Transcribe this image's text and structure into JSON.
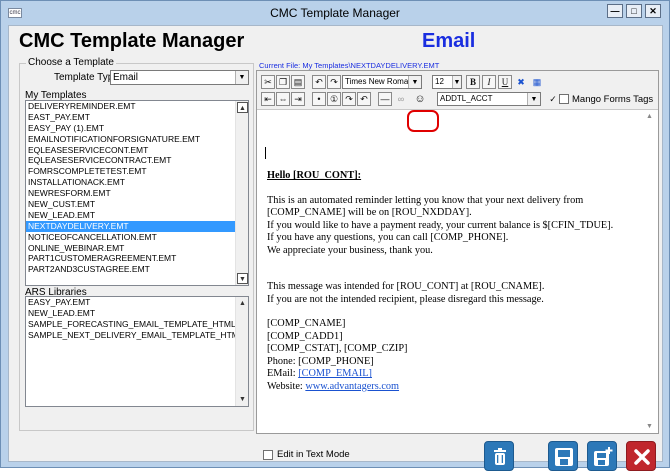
{
  "window": {
    "title": "CMC Template Manager",
    "app_icon": "app-icon",
    "controls": [
      "minimize",
      "maximize",
      "close"
    ]
  },
  "header": {
    "app_title": "CMC Template Manager",
    "mode_title": "Email"
  },
  "choose_template": {
    "group_label": "Choose a Template",
    "template_type_label": "Template Type",
    "template_type_value": "Email"
  },
  "my_templates": {
    "label": "My Templates",
    "items": [
      "DELIVERYREMINDER.EMT",
      "EAST_PAY.EMT",
      "EASY_PAY (1).EMT",
      "EMAILNOTIFICATIONFORSIGNATURE.EMT",
      "EQLEASESERVICECONT.EMT",
      "EQLEASESERVICECONTRACT.EMT",
      "FOMRSCOMPLETETEST.EMT",
      "INSTALLATIONACK.EMT",
      "NEWRESFORM.EMT",
      "NEW_CUST.EMT",
      "NEW_LEAD.EMT",
      "NEXTDAYDELIVERY.EMT",
      "NOTICEOFCANCELLATION.EMT",
      "ONLINE_WEBINAR.EMT",
      "PART1CUSTOMERAGREEMENT.EMT",
      "PART2AND3CUSTAGREE.EMT"
    ],
    "selected_index": 11
  },
  "ars_libraries": {
    "label": "ARS Libraries",
    "items": [
      "EASY_PAY.EMT",
      "NEW_LEAD.EMT",
      "SAMPLE_FORECASTING_EMAIL_TEMPLATE_HTML.EMT",
      "SAMPLE_NEXT_DELIVERY_EMAIL_TEMPLATE_HTML.EMT"
    ]
  },
  "editor": {
    "current_file": "Current File: My Templates\\NEXTDAYDELIVERY.EMT",
    "font_name": "Times New Roman",
    "font_size": "12",
    "bold": "B",
    "italic": "I",
    "underline": "U",
    "field_select": "ADDTL_ACCT",
    "mango_label": "Mango Forms Tags",
    "icons": {
      "cut": "scissors-icon",
      "copy": "copy-icon",
      "paste": "paste-icon",
      "undo": "undo-icon",
      "redo": "redo-icon",
      "align_left": "align-left-icon",
      "align_center": "align-center-icon",
      "bullet": "bullet-icon",
      "number": "numbering-icon",
      "indent": "indent-icon",
      "outdent": "outdent-icon",
      "line": "horizontal-line-icon",
      "link": "link-icon",
      "smiley": "smiley-icon",
      "spell": "spellcheck-icon",
      "table": "table-icon"
    },
    "document": {
      "greeting": "Hello [ROU_CONT]:",
      "paragraph1": [
        "This is an automated reminder letting you know that your next delivery from",
        "[COMP_CNAME] will be on [ROU_NXDDAY].",
        "If you would like to have a payment ready, your current balance is $[CFIN_TDUE].",
        "If you have any questions, you can call [COMP_PHONE].",
        "We appreciate your business, thank you."
      ],
      "paragraph2": [
        "This message was intended for [ROU_CONT] at [ROU_CNAME].",
        "If you are not the intended recipient, please disregard this message."
      ],
      "signature": [
        "[COMP_CNAME]",
        "[COMP_CADD1]",
        "[COMP_CSTAT], [COMP_CZIP]",
        "Phone: [COMP_PHONE]"
      ],
      "email_label": "EMail: ",
      "email_value": "[COMP_EMAIL]",
      "website_label": "Website: ",
      "website_value": "www.advantagers.com"
    }
  },
  "footer": {
    "edit_text_mode_label": "Edit in Text Mode",
    "buttons": [
      "trash-icon",
      "save-icon",
      "save-new-icon",
      "close-x-icon"
    ]
  },
  "colors": {
    "accent_blue": "#1a2ee0",
    "selection": "#3399ff",
    "button_blue": "#2c78b8",
    "button_red": "#c0272d",
    "highlight_ring": "#e00000"
  }
}
